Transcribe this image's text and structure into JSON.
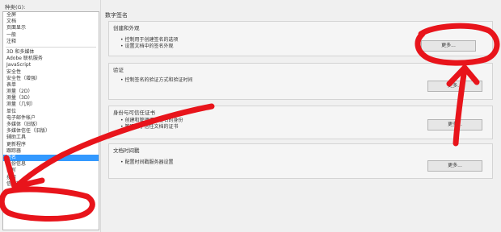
{
  "sidebar": {
    "label": "种类(G):",
    "top_items": [
      "全屏",
      "文档",
      "页面显示",
      "一般",
      "注释"
    ],
    "items": [
      "3D 和多媒体",
      "Adobe 联机服务",
      "JavaScript",
      "安全性",
      "安全性（增强）",
      "表单",
      "测量（2D）",
      "测量（3D）",
      "测量（几何）",
      "单位",
      "电子邮件帐户",
      "多媒体（旧版）",
      "多媒体信任（旧版）",
      "辅助工具",
      "更新程序",
      "跟踪器",
      "签名",
      "身份信息",
      "拼写",
      "搜索",
      "信任管理器"
    ],
    "selected_index": 16
  },
  "main": {
    "title": "数字签名",
    "sections": [
      {
        "title": "创建和外观",
        "lines": [
          "• 控制用于创建签名的选项",
          "• 设置文档中的签名外观"
        ],
        "button": "更多..."
      },
      {
        "title": "验证",
        "lines": [
          "• 控制签名的验证方式和验证时间"
        ],
        "button": "更多..."
      },
      {
        "title": "身份与可信任证书",
        "lines": [
          "• 创建和管理用于签名的身份",
          "• 管理用于信任文档的证书"
        ],
        "button": "更多..."
      },
      {
        "title": "文档时间戳",
        "lines": [
          "• 配置时间戳服务器设置"
        ],
        "button": "更多..."
      }
    ]
  },
  "colors": {
    "selection": "#3399ff",
    "annotation": "#e8141b"
  }
}
